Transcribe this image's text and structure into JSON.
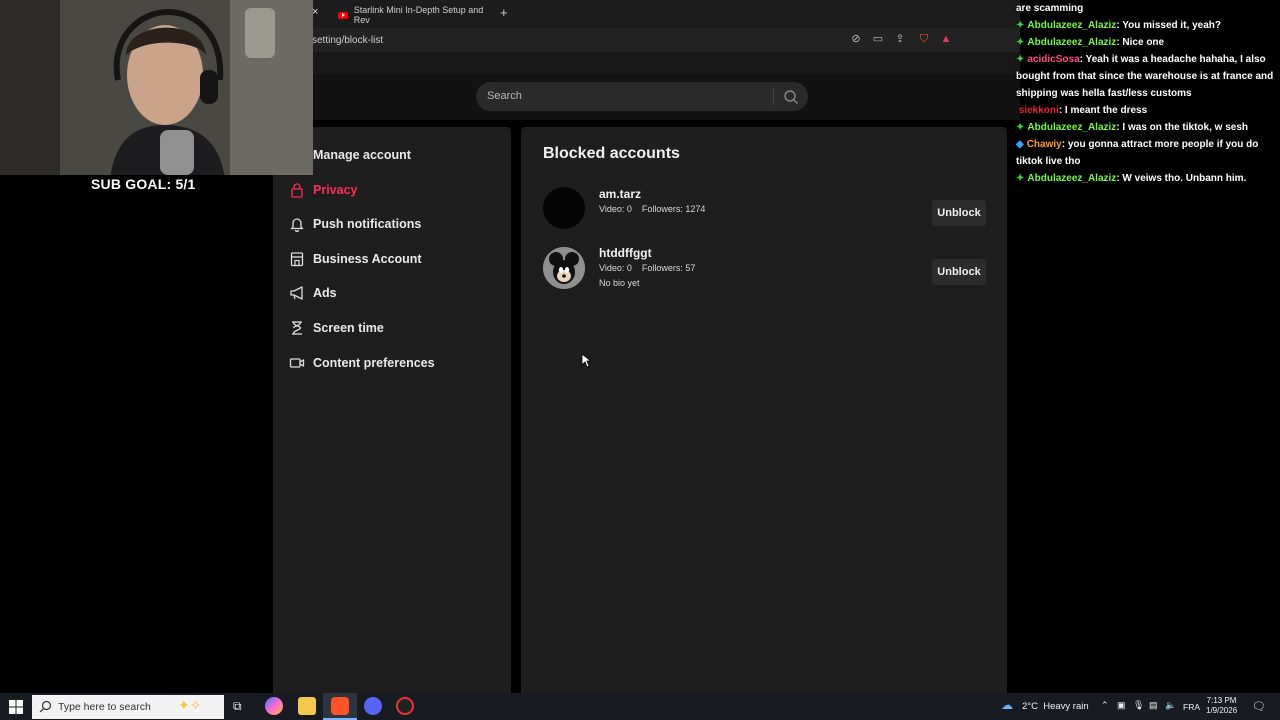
{
  "browser": {
    "tab_title": "Starlink Mini In-Depth Setup and Rev",
    "url": "setting/block-list",
    "new_tab": "+",
    "close_tab": "×"
  },
  "header": {
    "search_placeholder": "Search"
  },
  "settings_menu": {
    "items": [
      {
        "label": "Manage account",
        "icon": "person-icon",
        "active": false
      },
      {
        "label": "Privacy",
        "icon": "lock-icon",
        "active": true
      },
      {
        "label": "Push notifications",
        "icon": "bell-icon",
        "active": false
      },
      {
        "label": "Business Account",
        "icon": "store-icon",
        "active": false
      },
      {
        "label": "Ads",
        "icon": "megaphone-icon",
        "active": false
      },
      {
        "label": "Screen time",
        "icon": "hourglass-icon",
        "active": false
      },
      {
        "label": "Content preferences",
        "icon": "video-icon",
        "active": false
      }
    ]
  },
  "blocked": {
    "title": "Blocked accounts",
    "accounts": [
      {
        "username": "am.tarz",
        "stats": "Video: 0    Followers: 1274",
        "bio": "",
        "button": "Unblock"
      },
      {
        "username": "htddffggt",
        "stats": "Video: 0    Followers: 57",
        "bio": "No bio yet",
        "button": "Unblock"
      }
    ]
  },
  "overlay": {
    "sub_goal": "SUB GOAL: 5/1"
  },
  "chat": {
    "lines": [
      {
        "user": "",
        "text": "are scamming",
        "color": "#ffffff",
        "badge": ""
      },
      {
        "user": "Abdulazeez_Alaziz",
        "text": ": You missed it, yeah?",
        "color": "#7cf54a",
        "badge": "✦"
      },
      {
        "user": "Abdulazeez_Alaziz",
        "text": ": Nice one",
        "color": "#7cf54a",
        "badge": "✦"
      },
      {
        "user": "acidicSosa",
        "text": ": Yeah it was a headache hahaha, I also bought from that since the warehouse is at france and shipping was hella fast/less customs",
        "color": "#ff4c8c",
        "badge": "✦"
      },
      {
        "user": "siekkoni",
        "text": ": I meant the dress",
        "color": "#e0223a",
        "badge": ""
      },
      {
        "user": "Abdulazeez_Alaziz",
        "text": ": I was on the tiktok, w sesh",
        "color": "#7cf54a",
        "badge": "✦"
      },
      {
        "user": "Chawiy",
        "text": ": you gonna attract more people if you do tiktok live tho",
        "color": "#ff9a3c",
        "badge": "◆"
      },
      {
        "user": "Abdulazeez_Alaziz",
        "text": ": W veiws tho. Unbann him.",
        "color": "#7cf54a",
        "badge": "✦"
      }
    ]
  },
  "taskbar": {
    "search_placeholder": "Type here to search",
    "weather": "2°C  Heavy rain",
    "lang": "FRA",
    "time": "7:13 PM",
    "date": "1/9/2026"
  }
}
